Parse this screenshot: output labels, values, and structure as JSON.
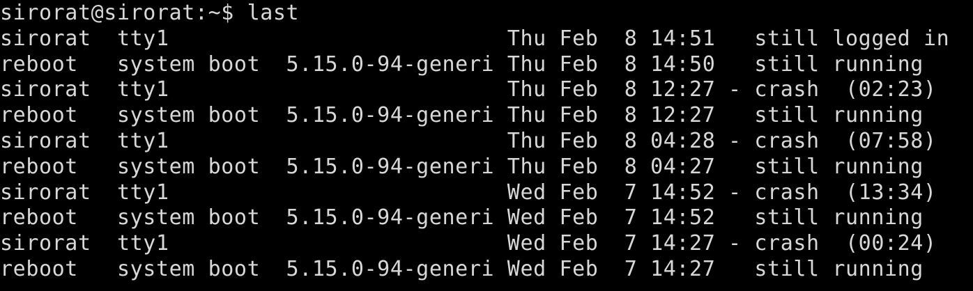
{
  "terminal": {
    "prompt": "sirorat@sirorat:~$ last",
    "lines": [
      "sirorat  tty1                          Thu Feb  8 14:51   still logged in",
      "reboot   system boot  5.15.0-94-generi Thu Feb  8 14:50   still running",
      "sirorat  tty1                          Thu Feb  8 12:27 - crash  (02:23)",
      "reboot   system boot  5.15.0-94-generi Thu Feb  8 12:27   still running",
      "sirorat  tty1                          Thu Feb  8 04:28 - crash  (07:58)",
      "reboot   system boot  5.15.0-94-generi Thu Feb  8 04:27   still running",
      "sirorat  tty1                          Wed Feb  7 14:52 - crash  (13:34)",
      "reboot   system boot  5.15.0-94-generi Wed Feb  7 14:52   still running",
      "sirorat  tty1                          Wed Feb  7 14:27 - crash  (00:24)",
      "reboot   system boot  5.15.0-94-generi Wed Feb  7 14:27   still running"
    ]
  },
  "colors": {
    "background": "#000000",
    "text": "#d8d8d8"
  }
}
